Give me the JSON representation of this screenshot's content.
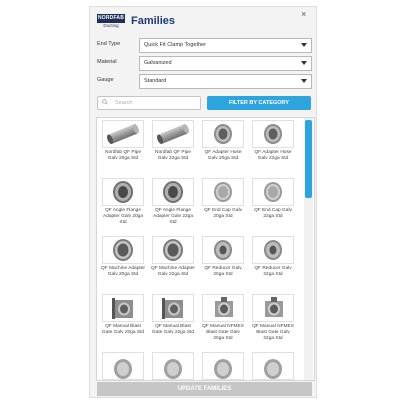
{
  "header": {
    "logo_text": "NORDFAB",
    "logo_sub": "Ducting",
    "title": "Families",
    "close": "×"
  },
  "filters": [
    {
      "label": "End Type",
      "value": "Quick Fit Clamp Together"
    },
    {
      "label": "Material",
      "value": "Galvanized"
    },
    {
      "label": "Gauge",
      "value": "Standard"
    }
  ],
  "search": {
    "placeholder": "Search"
  },
  "filter_button": "FILTER BY CATEGORY",
  "families": [
    {
      "name": "Nordfab QF Pipe Galv 20ga Std",
      "icon": "pipe-icon"
    },
    {
      "name": "Nordfab QF Pipe Galv 22ga Std",
      "icon": "pipe-icon"
    },
    {
      "name": "QF Adapter Hose Galv 20ga Std",
      "icon": "adapter-icon"
    },
    {
      "name": "QF Adapter Hose Galv 22ga Std",
      "icon": "adapter-icon"
    },
    {
      "name": "QF Angle Flange Adapter Galv 20ga Std",
      "icon": "flange-icon"
    },
    {
      "name": "QF Angle Flange Adapter Galv 22ga Std",
      "icon": "flange-icon"
    },
    {
      "name": "QF End Cap Galv 20ga Std",
      "icon": "end-cap-icon"
    },
    {
      "name": "QF End Cap Galv 22ga Std",
      "icon": "end-cap-icon"
    },
    {
      "name": "QF Machine Adapter Galv 20ga Std",
      "icon": "machine-adapter-icon"
    },
    {
      "name": "QF Machine Adapter Galv 22ga Std",
      "icon": "machine-adapter-icon"
    },
    {
      "name": "QF Reducer Galv 20ga Std",
      "icon": "reducer-icon"
    },
    {
      "name": "QF Reducer Galv 22ga Std",
      "icon": "reducer-icon"
    },
    {
      "name": "QF Manual Blast Gate Galv 20ga Std",
      "icon": "blast-gate-icon"
    },
    {
      "name": "QF Manual Blast Gate Galv 22ga Std",
      "icon": "blast-gate-icon"
    },
    {
      "name": "QF Manual NFMES Blast Gate Galv 20ga Std",
      "icon": "nfmes-gate-icon"
    },
    {
      "name": "QF Manual NFMES Blast Gate Galv 22ga Std",
      "icon": "nfmes-gate-icon"
    },
    {
      "name": "",
      "icon": "part-icon"
    },
    {
      "name": "",
      "icon": "part-icon"
    },
    {
      "name": "",
      "icon": "part-icon"
    },
    {
      "name": "",
      "icon": "part-icon"
    }
  ],
  "update_button": "UPDATE FAMILIES",
  "colors": {
    "accent": "#2ea4de",
    "brand": "#1e3a78",
    "disabled": "#c6c6c6"
  }
}
